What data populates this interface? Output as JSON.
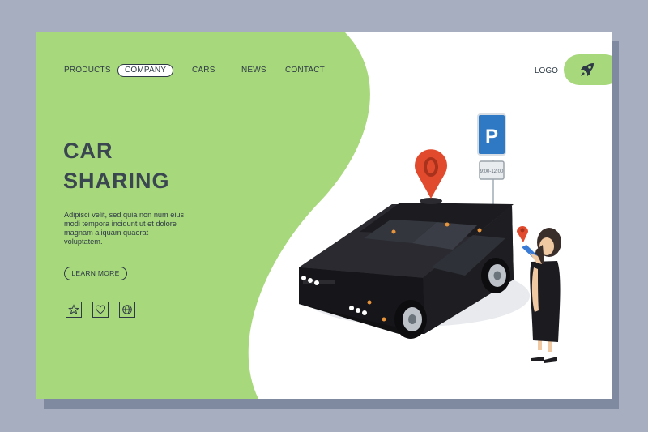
{
  "nav": {
    "items": [
      "PRODUCTS",
      "COMPANY",
      "CARS",
      "NEWS",
      "CONTACT"
    ],
    "active": "COMPANY"
  },
  "logo": {
    "label": "LOGO",
    "icon": "rocket-icon"
  },
  "hero": {
    "title_line1": "CAR",
    "title_line2": "SHARING",
    "description": "Adipisci velit, sed quia non num eius modi tempora incidunt ut et dolore magnam aliquam quaerat voluptatem.",
    "cta_label": "LEARN MORE"
  },
  "social_icons": [
    "star-icon",
    "heart-icon",
    "globe-icon"
  ],
  "illustration": {
    "parking_sign": "P",
    "plate_text": "9:00-12:00"
  },
  "colors": {
    "accent_green": "#a8d87c",
    "text_dark": "#2d3a45",
    "pin_red": "#e24a2d",
    "car_black": "#1e1e22",
    "sign_blue": "#2f78c4"
  }
}
